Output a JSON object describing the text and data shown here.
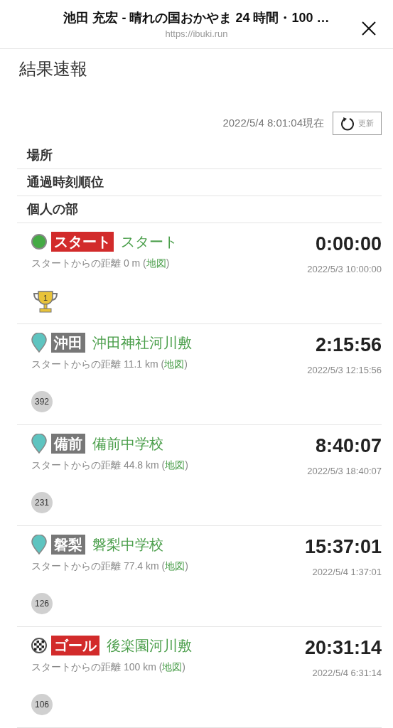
{
  "header": {
    "title": "池田 充宏 - 晴れの国おかやま 24 時間・100 …",
    "url": "https://ibuki.run"
  },
  "page_title": "結果速報",
  "updated": {
    "timestamp": "2022/5/4 8:01:04現在",
    "button": "更新"
  },
  "sections": [
    "場所",
    "通過時刻順位",
    "個人の部"
  ],
  "points": [
    {
      "kind": "start",
      "tag": "スタート",
      "place": "スタート",
      "distance": "スタートからの距離 0 m (",
      "map_link": "地図",
      "close": ")",
      "elapsed": "0:00:00",
      "time": "2022/5/3 10:00:00",
      "rank": {
        "kind": "trophy",
        "value": "1"
      }
    },
    {
      "kind": "checkpoint",
      "tag": "沖田",
      "place": "沖田神社河川敷",
      "distance": "スタートからの距離 11.1 km (",
      "map_link": "地図",
      "close": ")",
      "elapsed": "2:15:56",
      "time": "2022/5/3 12:15:56",
      "rank": {
        "kind": "circle",
        "value": "392"
      }
    },
    {
      "kind": "checkpoint",
      "tag": "備前",
      "place": "備前中学校",
      "distance": "スタートからの距離 44.8 km (",
      "map_link": "地図",
      "close": ")",
      "elapsed": "8:40:07",
      "time": "2022/5/3 18:40:07",
      "rank": {
        "kind": "circle",
        "value": "231"
      }
    },
    {
      "kind": "checkpoint",
      "tag": "磐梨",
      "place": "磐梨中学校",
      "distance": "スタートからの距離 77.4 km (",
      "map_link": "地図",
      "close": ")",
      "elapsed": "15:37:01",
      "time": "2022/5/4 1:37:01",
      "rank": {
        "kind": "circle",
        "value": "126"
      }
    },
    {
      "kind": "goal",
      "tag": "ゴール",
      "place": "後楽園河川敷",
      "distance": "スタートからの距離 100 km (",
      "map_link": "地図",
      "close": ")",
      "elapsed": "20:31:14",
      "time": "2022/5/4 6:31:14",
      "rank": {
        "kind": "circle",
        "value": "106"
      }
    }
  ]
}
